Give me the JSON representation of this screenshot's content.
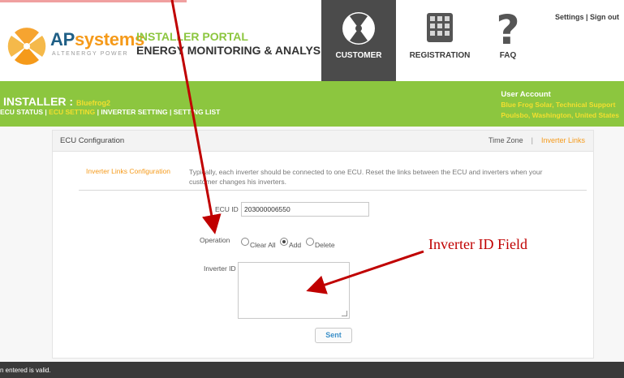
{
  "header": {
    "brand_ap": "AP",
    "brand_sys": "systems",
    "tagline": "ALTENERGY POWER",
    "portal_title": "INSTALLER PORTAL",
    "portal_subtitle": "ENERGY MONITORING & ANALYSIS",
    "nav": {
      "customer": "CUSTOMER",
      "registration": "REGISTRATION",
      "faq": "FAQ"
    },
    "top_links": "Settings | Sign out"
  },
  "green_bar": {
    "installer_label": "INSTALLER :",
    "installer_name": "Bluefrog2",
    "links": {
      "ecu_status": "ECU STATUS",
      "sep1": " | ",
      "ecu_setting": "ECU SETTING",
      "sep2": " | ",
      "inverter_setting": "INVERTER SETTING",
      "sep3": " | ",
      "setting_list": "SETTING LIST"
    },
    "account": {
      "heading": "User Account",
      "company": "Blue Frog Solar, Technical Support",
      "location": "Poulsbo, Washington, United States"
    }
  },
  "panel": {
    "title": "ECU Configuration",
    "tab_time_zone": "Time Zone",
    "tab_separator": "|",
    "tab_inverter_links": "Inverter Links",
    "section_label": "Inverter Links Configuration",
    "section_desc": "Typically, each inverter should be connected to one ECU. Reset the links between the ECU and inverters when your customer changes his inverters.",
    "ecu_id_label": "ECU ID",
    "ecu_id_value": "203000006550",
    "operation_label": "Operation",
    "options": {
      "clear_all": "Clear All",
      "add": "Add",
      "delete": "Delete"
    },
    "selected_operation": "Add",
    "inverter_id_label": "Inverter ID",
    "sent_button": "Sent"
  },
  "status_bar": "n entered is valid.",
  "annotation": "Inverter ID Field",
  "colors": {
    "green": "#8cc63f",
    "orange": "#f59a1a",
    "brand_blue": "#1f5f86",
    "yellow_link": "#f3df2e",
    "arrow_red": "#c00000"
  }
}
